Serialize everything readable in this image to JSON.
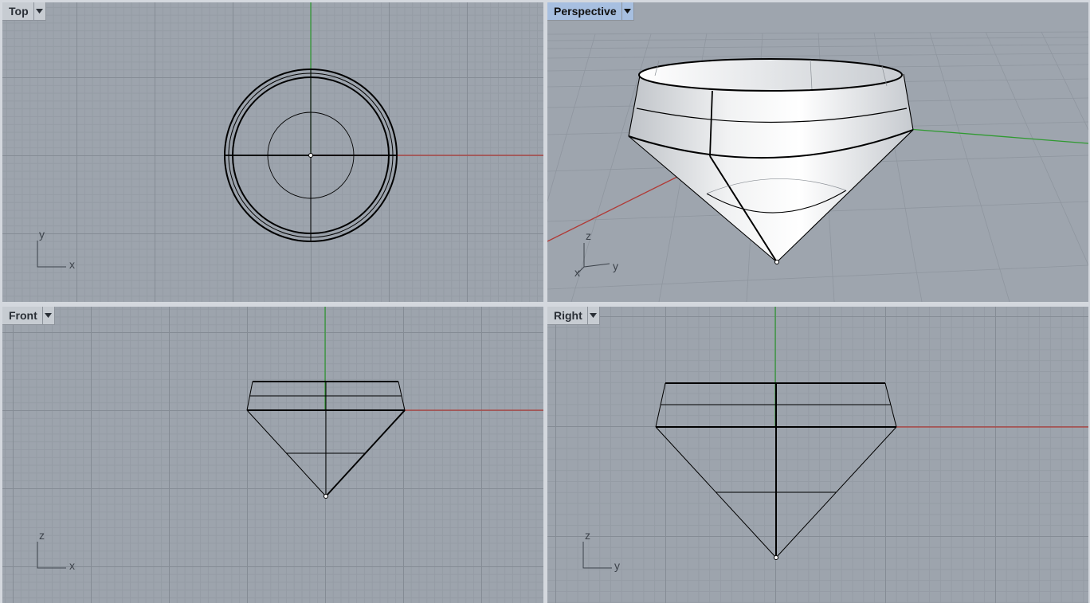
{
  "viewports": {
    "top": {
      "title": "Top",
      "axes": {
        "a": "y",
        "b": "x"
      }
    },
    "persp": {
      "title": "Perspective",
      "axes": {
        "a": "z",
        "b": "y",
        "c": "x"
      }
    },
    "front": {
      "title": "Front",
      "axes": {
        "a": "z",
        "b": "x"
      }
    },
    "right": {
      "title": "Right",
      "axes": {
        "a": "z",
        "b": "y"
      }
    }
  },
  "active_viewport": "Perspective",
  "colors": {
    "x_axis": "#b03a36",
    "y_axis": "#2f9a30",
    "curve": "#000000",
    "grid_minor": "#959ca5",
    "grid_major": "#858c95",
    "background": "#9da4ad",
    "active_tab": "#a7bfe0"
  },
  "icons": {
    "dropdown": "chevron-down-icon",
    "axis_widget": "axis-triad-icon"
  }
}
